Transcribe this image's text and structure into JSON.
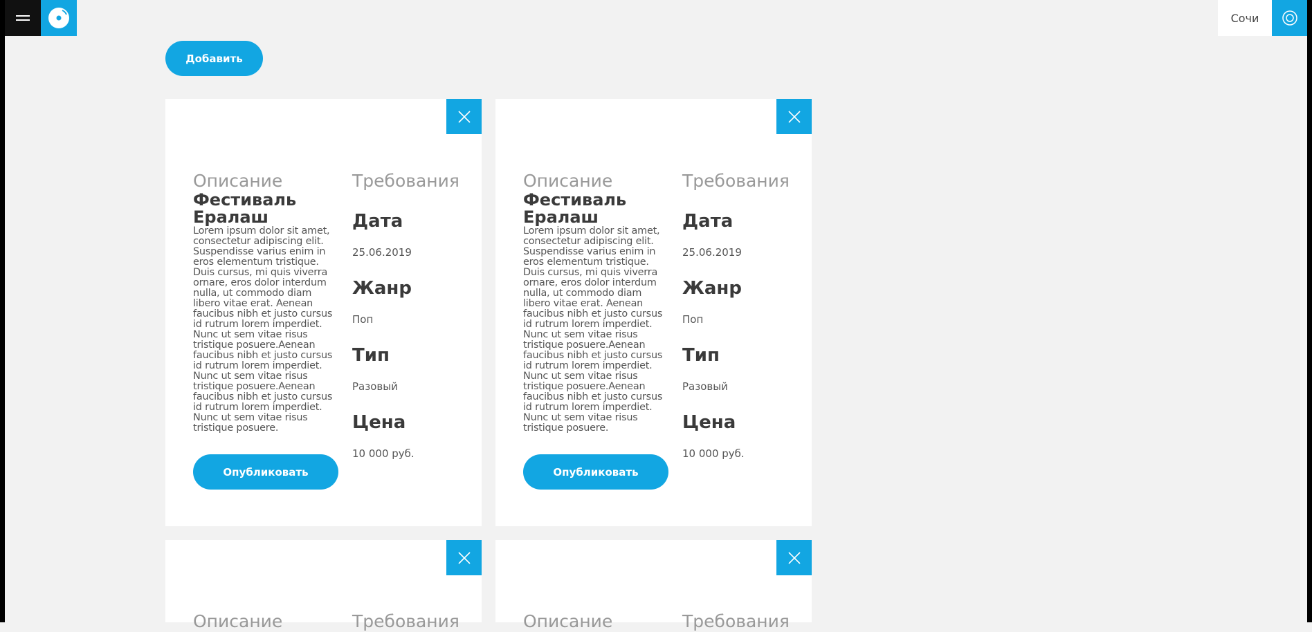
{
  "header": {
    "city": "Сочи"
  },
  "toolbar": {
    "add_label": "Добавить"
  },
  "cards": [
    {
      "description_heading": "Описание",
      "title": "Фестиваль Ералаш",
      "description": "Lorem ipsum dolor sit amet, consectetur adipiscing elit. Suspendisse varius enim in eros elementum tristique. Duis cursus, mi quis viverra ornare, eros dolor interdum nulla, ut commodo diam libero vitae erat. Aenean faucibus nibh et justo cursus id rutrum lorem imperdiet. Nunc ut sem vitae risus tristique posuere.Aenean faucibus nibh et justo cursus id rutrum lorem imperdiet. Nunc ut sem vitae risus tristique posuere.Aenean faucibus nibh et justo cursus id rutrum lorem imperdiet. Nunc ut sem vitae risus tristique posuere.",
      "requirements_heading": "Требования",
      "date_label": "Дата",
      "date_value": "25.06.2019",
      "genre_label": "Жанр",
      "genre_value": "Поп",
      "type_label": "Тип",
      "type_value": "Разовый",
      "price_label": "Цена",
      "price_value": "10 000 руб.",
      "publish_label": "Опубликовать"
    },
    {
      "description_heading": "Описание",
      "title": "Фестиваль Ералаш",
      "description": "Lorem ipsum dolor sit amet, consectetur adipiscing elit. Suspendisse varius enim in eros elementum tristique. Duis cursus, mi quis viverra ornare, eros dolor interdum nulla, ut commodo diam libero vitae erat. Aenean faucibus nibh et justo cursus id rutrum lorem imperdiet. Nunc ut sem vitae risus tristique posuere.Aenean faucibus nibh et justo cursus id rutrum lorem imperdiet. Nunc ut sem vitae risus tristique posuere.Aenean faucibus nibh et justo cursus id rutrum lorem imperdiet. Nunc ut sem vitae risus tristique posuere.",
      "requirements_heading": "Требования",
      "date_label": "Дата",
      "date_value": "25.06.2019",
      "genre_label": "Жанр",
      "genre_value": "Поп",
      "type_label": "Тип",
      "type_value": "Разовый",
      "price_label": "Цена",
      "price_value": "10 000 руб.",
      "publish_label": "Опубликовать"
    },
    {
      "description_heading": "Описание",
      "requirements_heading": "Требования"
    },
    {
      "description_heading": "Описание",
      "requirements_heading": "Требования"
    }
  ],
  "colors": {
    "accent": "#12a6e2",
    "background": "#f2f2f2"
  },
  "icons": {
    "menu": "hamburger-icon",
    "logo": "disc-logo-icon",
    "profile": "profile-ring-icon",
    "close": "close-icon"
  }
}
